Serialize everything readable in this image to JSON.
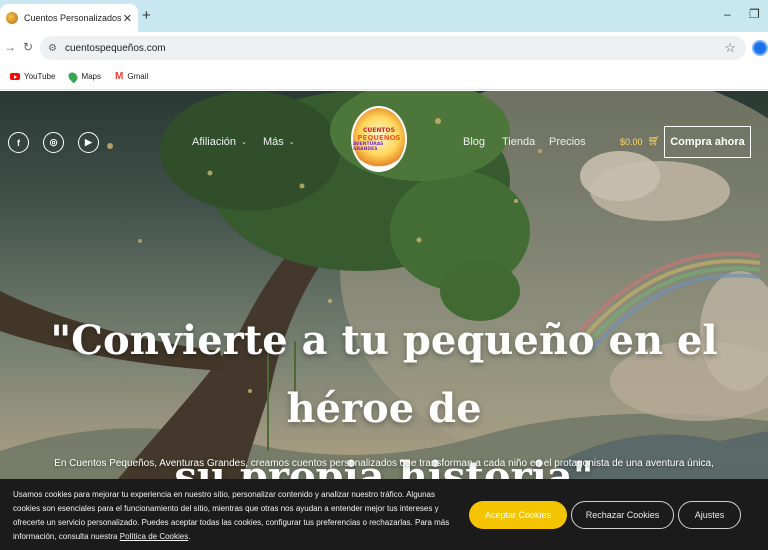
{
  "browser": {
    "tab_title": "Cuentos Personalizados - Cuen",
    "tab_close": "✕",
    "new_tab": "+",
    "minimize": "–",
    "restore": "❐",
    "url": "cuentospequeños.com",
    "bookmarks": [
      {
        "label": "YouTube",
        "icon": "youtube-icon"
      },
      {
        "label": "Maps",
        "icon": "maps-icon"
      },
      {
        "label": "Gmail",
        "icon": "gmail-icon"
      }
    ]
  },
  "site": {
    "nav": {
      "affiliation": "Afiliación",
      "more": "Más",
      "blog": "Blog",
      "store": "Tienda",
      "prices": "Precios",
      "cart_total": "$0.00",
      "buy_now": "Compra ahora"
    },
    "logo": {
      "line1": "CUENTOS",
      "line2": "PEQUEÑOS",
      "line3": "AVENTURAS GRANDES"
    },
    "hero": {
      "headline_line1": "\"Convierte a tu pequeño en el héroe de",
      "headline_line2": "su propia historia\"",
      "subtext": "En Cuentos Pequeños, Aventuras Grandes, creamos cuentos personalizados que transforman a cada niño en el protagonista de una aventura única,"
    },
    "social": [
      {
        "icon": "facebook-icon",
        "glyph": "f"
      },
      {
        "icon": "instagram-icon",
        "glyph": "◎"
      },
      {
        "icon": "youtube-icon",
        "glyph": "▶"
      }
    ]
  },
  "cookie_banner": {
    "text": "Usamos cookies para mejorar tu experiencia en nuestro sitio, personalizar contenido y analizar nuestro tráfico. Algunas cookies son esenciales para el funcionamiento del sitio, mientras que otras nos ayudan a entender mejor tus intereses y ofrecerte un servicio personalizado. Puedes aceptar todas las cookies, configurar tus preferencias o rechazarlas. Para más información, consulta nuestra",
    "policy_link": "Política de Cookies",
    "policy_suffix": ".",
    "accept": "Aceptar Cookies",
    "reject": "Rechazar Cookies",
    "settings": "Ajustes"
  },
  "colors": {
    "tabbar": "#c9e7f0",
    "accent_yellow": "#f5c400",
    "cookie_bg": "#1b1b1b"
  }
}
